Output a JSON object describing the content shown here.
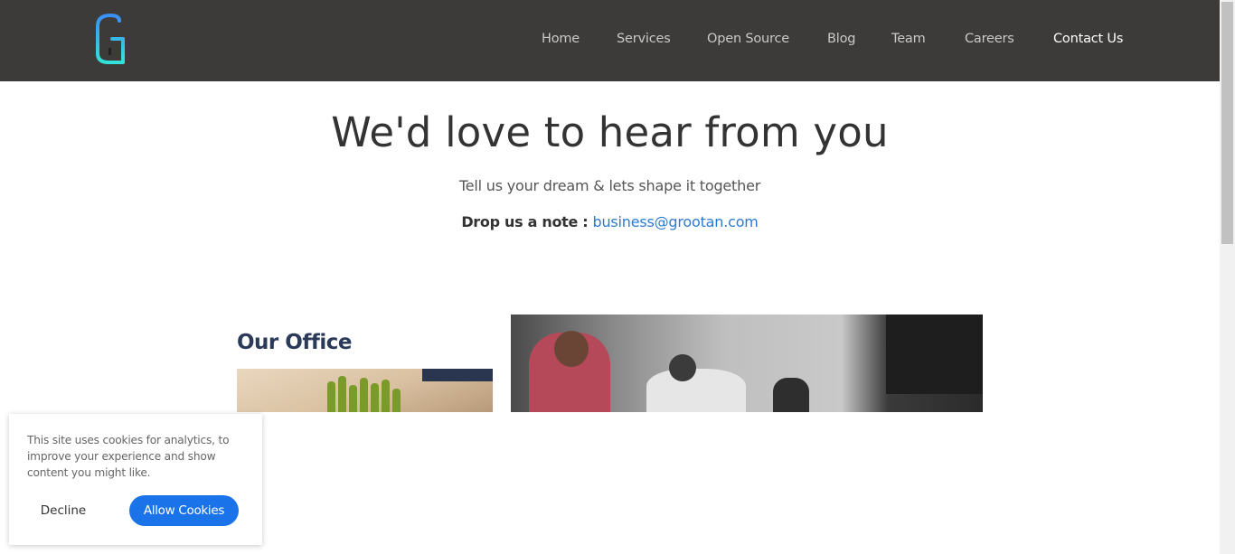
{
  "header": {
    "logo_icon": "grootan-g-logo",
    "nav": [
      {
        "label": "Home"
      },
      {
        "label": "Services"
      },
      {
        "label": "Open Source"
      },
      {
        "label": "Blog"
      },
      {
        "label": "Team"
      },
      {
        "label": "Careers"
      },
      {
        "label": "Contact Us",
        "active": true
      }
    ]
  },
  "hero": {
    "title": "We'd love to hear from you",
    "subtitle": "Tell us your dream & lets shape it together",
    "note_label": "Drop us a note :",
    "email": "business@grootan.com"
  },
  "gallery": {
    "office_label": "Our Office"
  },
  "cookie_banner": {
    "text": "This site uses cookies for analytics, to improve your experience and show content you might like.",
    "decline_label": "Decline",
    "allow_label": "Allow Cookies"
  },
  "colors": {
    "header_bg": "#3c3b39",
    "accent": "#1a73e8",
    "link": "#2b7bd2"
  }
}
